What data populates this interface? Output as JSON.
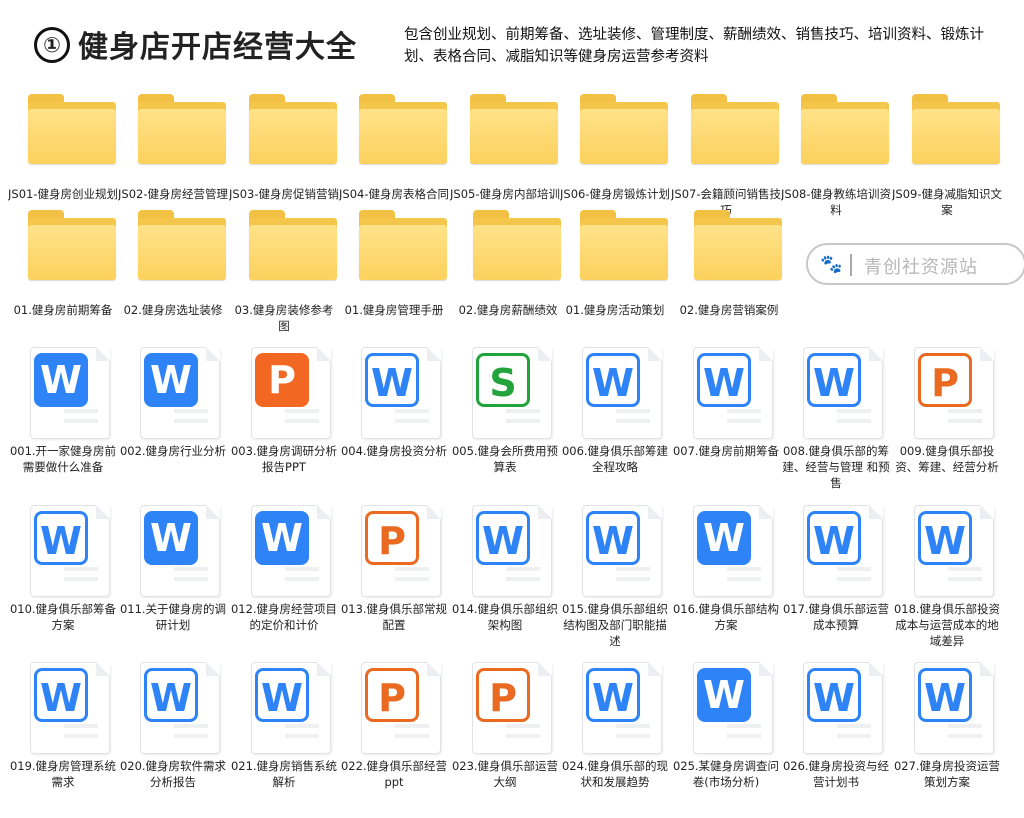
{
  "header": {
    "badge": "①",
    "title": "健身店开店经营大全",
    "description": "包含创业规划、前期筹备、选址装修、管理制度、薪酬绩效、销售技巧、培训资料、锻炼计划、表格合同、减脂知识等健身房运营参考资料"
  },
  "watermark": {
    "text": "青创社资源站",
    "icon": "paw-icon"
  },
  "folders_row1": [
    "JS01-健身房创业规划",
    "JS02-健身房经营管理",
    "JS03-健身房促销营销",
    "JS04-健身房表格合同",
    "JS05-健身房内部培训",
    "JS06-健身房锻炼计划",
    "JS07-会籍顾问销售技巧",
    "JS08-健身教练培训资料",
    "JS09-健身减脂知识文案"
  ],
  "folders_row2": [
    "01.健身房前期筹备",
    "02.健身房选址装修",
    "03.健身房装修参考图",
    "01.健身房管理手册",
    "02.健身房薪酬绩效",
    "01.健身房活动策划",
    "02.健身房营销案例"
  ],
  "files_row1": [
    {
      "label": "001.开一家健身房前需要做什么准备",
      "type": "wps-solid"
    },
    {
      "label": "002.健身房行业分析",
      "type": "wps-solid"
    },
    {
      "label": "003.健身房调研分析报告PPT",
      "type": "ppt-solid"
    },
    {
      "label": "004.健身房投资分析",
      "type": "wps-outline"
    },
    {
      "label": "005.健身会所费用预算表",
      "type": "xls-outline"
    },
    {
      "label": "006.健身俱乐部筹建全程攻略",
      "type": "wps-outline"
    },
    {
      "label": "007.健身房前期筹备",
      "type": "wps-outline"
    },
    {
      "label": "008.健身俱乐部的筹建、经营与管理 和预售",
      "type": "wps-outline"
    },
    {
      "label": "009.健身俱乐部投资、筹建、经营分析",
      "type": "ppt-outline"
    }
  ],
  "files_row2": [
    {
      "label": "010.健身俱乐部筹备方案",
      "type": "wps-outline"
    },
    {
      "label": "011.关于健身房的调研计划",
      "type": "wps-solid"
    },
    {
      "label": "012.健身房经营项目的定价和计价",
      "type": "wps-solid"
    },
    {
      "label": "013.健身俱乐部常规配置",
      "type": "ppt-outline"
    },
    {
      "label": "014.健身俱乐部组织架构图",
      "type": "wps-outline"
    },
    {
      "label": "015.健身俱乐部组织结构图及部门职能描述",
      "type": "wps-outline"
    },
    {
      "label": "016.健身俱乐部结构方案",
      "type": "wps-solid"
    },
    {
      "label": "017.健身俱乐部运营成本预算",
      "type": "wps-outline"
    },
    {
      "label": "018.健身俱乐部投资成本与运营成本的地域差异",
      "type": "wps-outline"
    }
  ],
  "files_row3": [
    {
      "label": "019.健身房管理系统需求",
      "type": "wps-outline"
    },
    {
      "label": "020.健身房软件需求分析报告",
      "type": "wps-outline"
    },
    {
      "label": "021.健身房销售系统解析",
      "type": "wps-outline"
    },
    {
      "label": "022.健身俱乐部经营ppt",
      "type": "ppt-outline"
    },
    {
      "label": "023.健身俱乐部运营大纲",
      "type": "ppt-outline"
    },
    {
      "label": "024.健身俱乐部的现状和发展趋势",
      "type": "wps-outline"
    },
    {
      "label": "025.某健身房调查问卷(市场分析)",
      "type": "wps-solid"
    },
    {
      "label": "026.健身房投资与经营计划书",
      "type": "wps-outline"
    },
    {
      "label": "027.健身房投资运营策划方案",
      "type": "wps-outline"
    }
  ],
  "icon_glyphs": {
    "wps-solid": "W",
    "wps-outline": "W",
    "ppt-solid": "P",
    "ppt-outline": "P",
    "xls-outline": "S"
  },
  "colors": {
    "wps_blue": "#2e83f6",
    "ppt_orange": "#f26722",
    "xls_green": "#22a33c",
    "folder_yellow": "#fcd15d"
  }
}
